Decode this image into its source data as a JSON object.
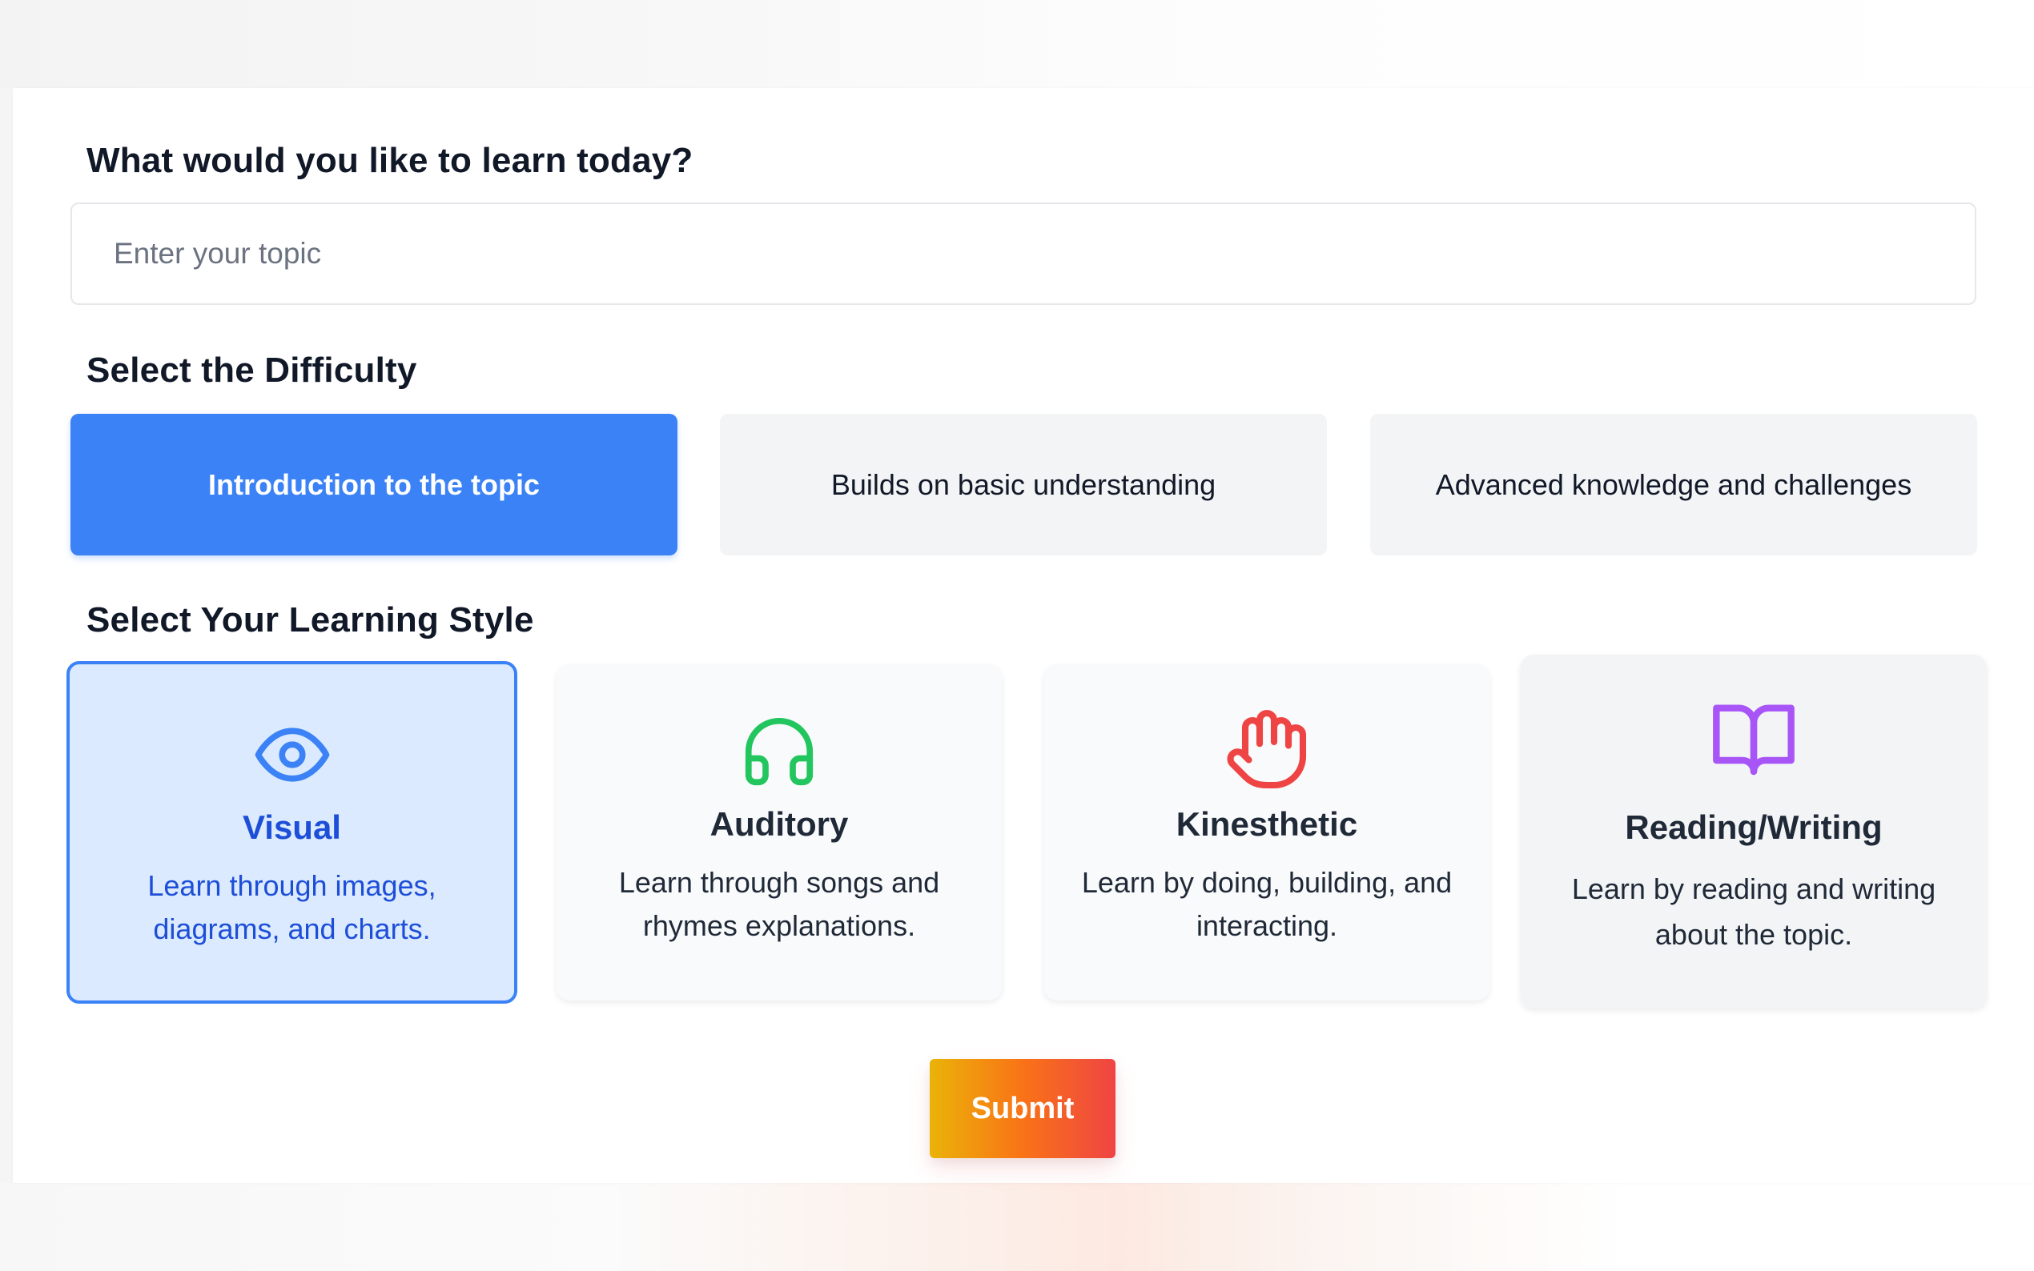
{
  "topic": {
    "heading": "What would you like to learn today?",
    "value": "",
    "placeholder": "Enter your topic"
  },
  "difficulty": {
    "heading": "Select the Difficulty",
    "selected_index": 0,
    "options": [
      {
        "label": "Introduction to the topic"
      },
      {
        "label": "Builds on basic understanding"
      },
      {
        "label": "Advanced knowledge and challenges"
      }
    ]
  },
  "learning_style": {
    "heading": "Select Your Learning Style",
    "selected_index": 0,
    "options": [
      {
        "title": "Visual",
        "description": "Learn through images, diagrams, and charts.",
        "icon": "eye-icon",
        "icon_color": "#3b82f6"
      },
      {
        "title": "Auditory",
        "description": "Learn through songs and rhymes explanations.",
        "icon": "headphones-icon",
        "icon_color": "#22c55e"
      },
      {
        "title": "Kinesthetic",
        "description": "Learn by doing, building, and interacting.",
        "icon": "hand-icon",
        "icon_color": "#ef4444"
      },
      {
        "title": "Reading/Writing",
        "description": "Learn by reading and writing about the topic.",
        "icon": "book-icon",
        "icon_color": "#a855f7"
      }
    ]
  },
  "submit": {
    "label": "Submit",
    "gradient": [
      "#eab308",
      "#f97316",
      "#ef4444"
    ]
  },
  "colors": {
    "accent": "#3b82f6",
    "selected_card_bg": "#dbeafe",
    "selected_text": "#1d4ed8"
  }
}
